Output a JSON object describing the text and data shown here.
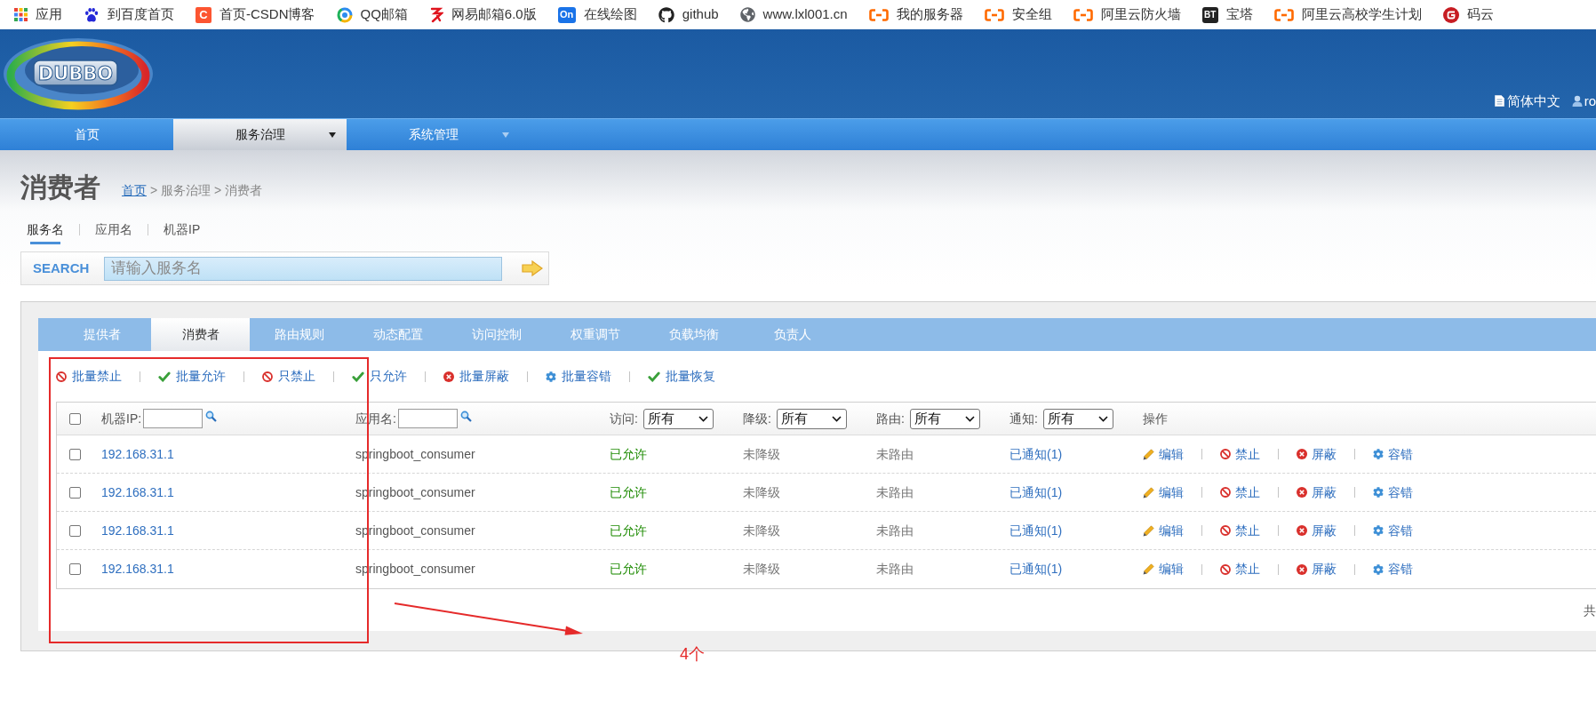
{
  "bookmarks": [
    {
      "kind": "grid",
      "label": "应用"
    },
    {
      "kind": "paw",
      "label": "到百度首页"
    },
    {
      "kind": "c-tile",
      "icon_text": "C",
      "label": "首页-CSDN博客"
    },
    {
      "kind": "swirl",
      "label": "QQ邮箱"
    },
    {
      "kind": "netease",
      "label": "网易邮箱6.0版"
    },
    {
      "kind": "on-tile",
      "icon_text": "On",
      "label": "在线绘图"
    },
    {
      "kind": "cat",
      "label": "github"
    },
    {
      "kind": "globe",
      "label": "www.lxl001.cn"
    },
    {
      "kind": "bracket",
      "label": "我的服务器"
    },
    {
      "kind": "bracket",
      "label": "安全组"
    },
    {
      "kind": "bracket",
      "label": "阿里云防火墙"
    },
    {
      "kind": "bt-tile",
      "icon_text": "BT",
      "label": "宝塔"
    },
    {
      "kind": "bracket",
      "label": "阿里云高校学生计划"
    },
    {
      "kind": "g-circle",
      "label": "码云"
    }
  ],
  "header": {
    "logo_text": "DUBBO",
    "language": "简体中文",
    "user": "ro"
  },
  "nav": [
    {
      "label": "首页",
      "selected": false,
      "dropdown": false
    },
    {
      "label": "服务治理",
      "selected": true,
      "dropdown": true
    },
    {
      "label": "系统管理",
      "selected": false,
      "dropdown": true
    }
  ],
  "page": {
    "title": "消费者",
    "breadcrumb_link": "首页",
    "breadcrumb_rest": "> 服务治理 > 消费者"
  },
  "search_types": [
    {
      "label": "服务名",
      "selected": true
    },
    {
      "label": "应用名",
      "selected": false
    },
    {
      "label": "机器IP",
      "selected": false
    }
  ],
  "search": {
    "label": "SEARCH",
    "placeholder": "请输入服务名"
  },
  "tabs": [
    {
      "label": "提供者",
      "selected": false
    },
    {
      "label": "消费者",
      "selected": true
    },
    {
      "label": "路由规则",
      "selected": false
    },
    {
      "label": "动态配置",
      "selected": false
    },
    {
      "label": "访问控制",
      "selected": false
    },
    {
      "label": "权重调节",
      "selected": false
    },
    {
      "label": "负载均衡",
      "selected": false
    },
    {
      "label": "负责人",
      "selected": false
    }
  ],
  "toolbar": [
    {
      "kind": "ban",
      "label": "批量禁止"
    },
    {
      "kind": "check",
      "label": "批量允许"
    },
    {
      "kind": "ban",
      "label": "只禁止"
    },
    {
      "kind": "check",
      "label": "只允许"
    },
    {
      "kind": "remove",
      "label": "批量屏蔽"
    },
    {
      "kind": "gear",
      "label": "批量容错"
    },
    {
      "kind": "check",
      "label": "批量恢复"
    }
  ],
  "table": {
    "select_all": {
      "checked": false
    },
    "columns": [
      {
        "kind": "input",
        "label": "机器IP:"
      },
      {
        "kind": "input",
        "label": "应用名:"
      },
      {
        "kind": "select",
        "label": "访问:",
        "value": "所有"
      },
      {
        "kind": "select",
        "label": "降级:",
        "value": "所有"
      },
      {
        "kind": "select",
        "label": "路由:",
        "value": "所有"
      },
      {
        "kind": "select",
        "label": "通知:",
        "value": "所有"
      },
      {
        "kind": "plain",
        "label": "操作"
      }
    ],
    "rows": [
      {
        "checked": false,
        "cells": [
          {
            "kind": "link",
            "text": "192.168.31.1"
          },
          {
            "kind": "text",
            "text": "springboot_consumer"
          },
          {
            "kind": "ok",
            "text": "已允许"
          },
          {
            "kind": "muted",
            "text": "未降级"
          },
          {
            "kind": "muted",
            "text": "未路由"
          },
          {
            "kind": "link",
            "text": "已通知(1)"
          }
        ],
        "actions": [
          {
            "kind": "edit",
            "label": "编辑"
          },
          {
            "kind": "ban",
            "label": "禁止"
          },
          {
            "kind": "remove",
            "label": "屏蔽"
          },
          {
            "kind": "gear",
            "label": "容错"
          }
        ]
      },
      {
        "checked": false,
        "cells": [
          {
            "kind": "link",
            "text": "192.168.31.1"
          },
          {
            "kind": "text",
            "text": "springboot_consumer"
          },
          {
            "kind": "ok",
            "text": "已允许"
          },
          {
            "kind": "muted",
            "text": "未降级"
          },
          {
            "kind": "muted",
            "text": "未路由"
          },
          {
            "kind": "link",
            "text": "已通知(1)"
          }
        ],
        "actions": [
          {
            "kind": "edit",
            "label": "编辑"
          },
          {
            "kind": "ban",
            "label": "禁止"
          },
          {
            "kind": "remove",
            "label": "屏蔽"
          },
          {
            "kind": "gear",
            "label": "容错"
          }
        ]
      },
      {
        "checked": false,
        "cells": [
          {
            "kind": "link",
            "text": "192.168.31.1"
          },
          {
            "kind": "text",
            "text": "springboot_consumer"
          },
          {
            "kind": "ok",
            "text": "已允许"
          },
          {
            "kind": "muted",
            "text": "未降级"
          },
          {
            "kind": "muted",
            "text": "未路由"
          },
          {
            "kind": "link",
            "text": "已通知(1)"
          }
        ],
        "actions": [
          {
            "kind": "edit",
            "label": "编辑"
          },
          {
            "kind": "ban",
            "label": "禁止"
          },
          {
            "kind": "remove",
            "label": "屏蔽"
          },
          {
            "kind": "gear",
            "label": "容错"
          }
        ]
      },
      {
        "checked": false,
        "cells": [
          {
            "kind": "link",
            "text": "192.168.31.1"
          },
          {
            "kind": "text",
            "text": "springboot_consumer"
          },
          {
            "kind": "ok",
            "text": "已允许"
          },
          {
            "kind": "muted",
            "text": "未降级"
          },
          {
            "kind": "muted",
            "text": "未路由"
          },
          {
            "kind": "link",
            "text": "已通知(1)"
          }
        ],
        "actions": [
          {
            "kind": "edit",
            "label": "编辑"
          },
          {
            "kind": "ban",
            "label": "禁止"
          },
          {
            "kind": "remove",
            "label": "屏蔽"
          },
          {
            "kind": "gear",
            "label": "容错"
          }
        ]
      }
    ]
  },
  "pagination": {
    "text": "共"
  },
  "annotations": [
    {
      "kind": "box"
    },
    {
      "kind": "arrow"
    },
    {
      "kind": "note",
      "text": "4个"
    }
  ]
}
